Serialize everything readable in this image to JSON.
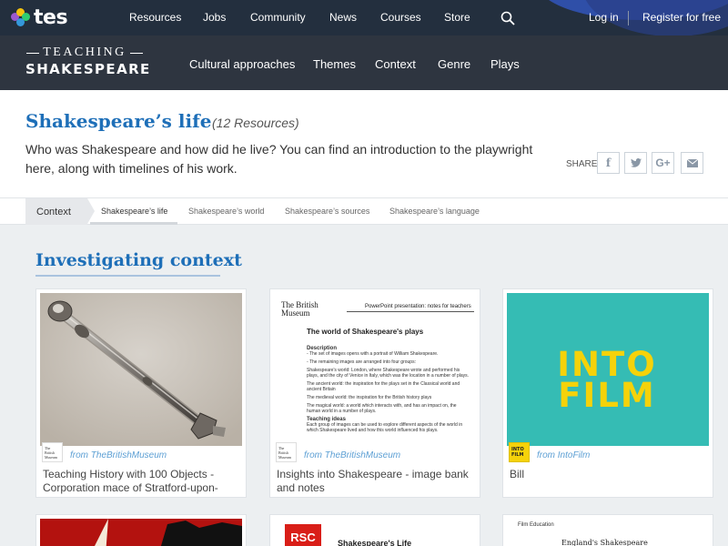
{
  "topnav": {
    "logo": "tes",
    "links": [
      "Resources",
      "Jobs",
      "Community",
      "News",
      "Courses",
      "Store"
    ],
    "login": "Log in",
    "register": "Register for free"
  },
  "brand": {
    "top": "TEACHING",
    "bottom": "SHAKESPEARE"
  },
  "subnav": [
    "Cultural approaches",
    "Themes",
    "Context",
    "Genre",
    "Plays"
  ],
  "page": {
    "title": "Shakespeare’s life",
    "count": "(12 Resources)",
    "intro": "Who was Shakespeare and how did he live? You can find an introduction to the playwright here, along with timelines of his work.",
    "share_label": "SHARE",
    "share_buttons": [
      "facebook-icon",
      "twitter-icon",
      "google-plus-icon",
      "email-icon"
    ]
  },
  "tabs": {
    "context": "Context",
    "items": [
      "Shakespeare’s life",
      "Shakespeare’s world",
      "Shakespeare’s sources",
      "Shakespeare’s language"
    ],
    "active": 0
  },
  "section": {
    "title": "Investigating context"
  },
  "cards": [
    {
      "source": "from TheBritishMuseum",
      "source_logo": "The British Museum",
      "title": "Teaching History with 100 Objects - Corporation mace of Stratford-upon-"
    },
    {
      "source": "from TheBritishMuseum",
      "source_logo": "The British Museum",
      "title": "Insights into Shakespeare - image bank and notes",
      "doc": {
        "org": "The British Museum",
        "header": "PowerPoint presentation: notes for teachers",
        "heading": "The world of Shakespeare's plays",
        "body": [
          "Description",
          "- The set of images opens with a portrait of William Shakespeare.",
          "- The remaining images are arranged into four groups:",
          "Shakespeare's world: London, where Shakespeare wrote and performed his plays, and the city of Venice in Italy, which was the location in a number of plays.",
          "The ancient world: the inspiration for the plays set in the Classical world and ancient Britain",
          "The medieval world: the inspiration for the British history plays",
          "The magical world: a world which interacts with, and has an impact on, the human world in a number of plays.",
          "Teaching ideas",
          "Each group of images can be used to explore different aspects of the world in which Shakespeare lived and how this world influenced his plays."
        ]
      }
    },
    {
      "source": "from IntoFilm",
      "source_logo": "INTO FILM",
      "title": "Bill",
      "image_text": "INTO FILM"
    }
  ],
  "cards_row2": [
    {
      "label": ""
    },
    {
      "logo": "RSC",
      "doc_title": "Shakespeare's Life"
    },
    {
      "logo": "Film Education",
      "doc_title": "England's Shakespeare"
    }
  ],
  "colors": {
    "topnav_bg": "#232f3e",
    "subnav_bg": "#2e3540",
    "title_blue": "#1e6fb8",
    "intofilm_teal": "#35bcb4",
    "intofilm_yellow": "#f5d20a"
  }
}
